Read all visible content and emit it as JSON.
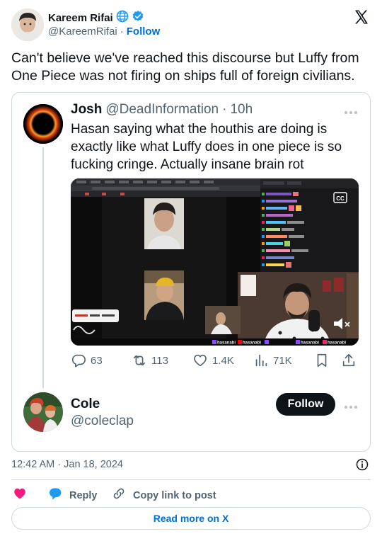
{
  "author": {
    "name": "Kareem Rifai",
    "handle": "@KareemRifai",
    "separator": "·",
    "follow_label": "Follow"
  },
  "post_text": "Can't believe we've reached this discourse but Luffy from One Piece was not firing on ships full of foreign civilians.",
  "quoted": {
    "name": "Josh",
    "handle": "@DeadInformation",
    "separator": "·",
    "time": "10h",
    "text": "Hasan saying what the houthis are doing is exactly like what Luffy does in one piece is so fucking cringe. Actually insane brain rot",
    "media_overlay_text": "hasanabi",
    "counts": {
      "replies": "63",
      "reposts": "113",
      "likes": "1.4K",
      "views": "71K"
    },
    "reply_author": {
      "name": "Cole",
      "handle": "@coleclap",
      "follow_label": "Follow"
    }
  },
  "timestamp": "12:42 AM · Jan 18, 2024",
  "footer": {
    "reply_label": "Reply",
    "copy_label": "Copy link to post",
    "read_more_label": "Read more on X"
  },
  "colors": {
    "accent": "#1d9bf0",
    "link": "#006fd6",
    "heart": "#f91880",
    "text": "#0f1419",
    "muted": "#536471",
    "border": "#cfd9de"
  }
}
